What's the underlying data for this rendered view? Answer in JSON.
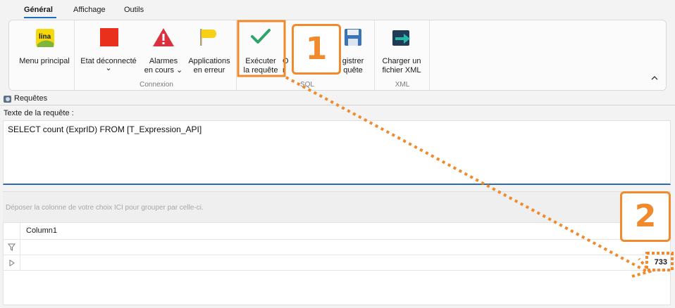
{
  "tabs": [
    "Général",
    "Affichage",
    "Outils"
  ],
  "ribbon": {
    "menu_principal": {
      "label": "Menu principal",
      "logo_text": "lina"
    },
    "etat": {
      "label": "Etat déconnecté",
      "chevron": "⌄"
    },
    "alarmes": {
      "label": "Alarmes\nen cours ⌄"
    },
    "applications": {
      "label": "Applications\nen erreur"
    },
    "executer": {
      "label": "Exécuter\nla requête"
    },
    "ouvrir": {
      "label": "O\nr"
    },
    "enregistrer": {
      "label": "gistrer\nquête"
    },
    "charger": {
      "label": "Charger un\nfichier XML"
    },
    "groups": {
      "connexion": "Connexion",
      "sql": "SQL",
      "xml": "XML"
    },
    "collapse_glyph": "^"
  },
  "panel": {
    "title": "Requêtes"
  },
  "query": {
    "label": "Texte de la requête :",
    "text": "SELECT count (ExprID) FROM [T_Expression_API]"
  },
  "group_hint": "Déposer la colonne de votre choix ICI pour grouper par celle-ci.",
  "grid": {
    "column": "Column1",
    "value": "733"
  },
  "annotations": {
    "step1": "1",
    "step2": "2"
  },
  "colors": {
    "accent_orange": "#f08a2c",
    "stop_red": "#e8301c",
    "alarm_red": "#d9313d",
    "check_green": "#2fa36b",
    "focus_blue": "#2b6cb0"
  }
}
